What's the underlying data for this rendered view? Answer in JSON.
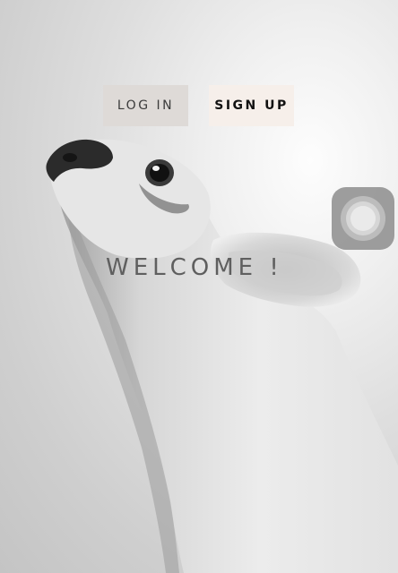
{
  "auth": {
    "login_label": "LOG IN",
    "signup_label": "SIGN UP"
  },
  "hero": {
    "welcome_text": "WELCOME !",
    "background_image": "dog-photo"
  },
  "overlay": {
    "assistive_touch_icon": "assistive-touch-icon"
  },
  "colors": {
    "login_bg": "#dedad7",
    "signup_bg": "#f6efea",
    "welcome_text": "#5f5f5f"
  }
}
